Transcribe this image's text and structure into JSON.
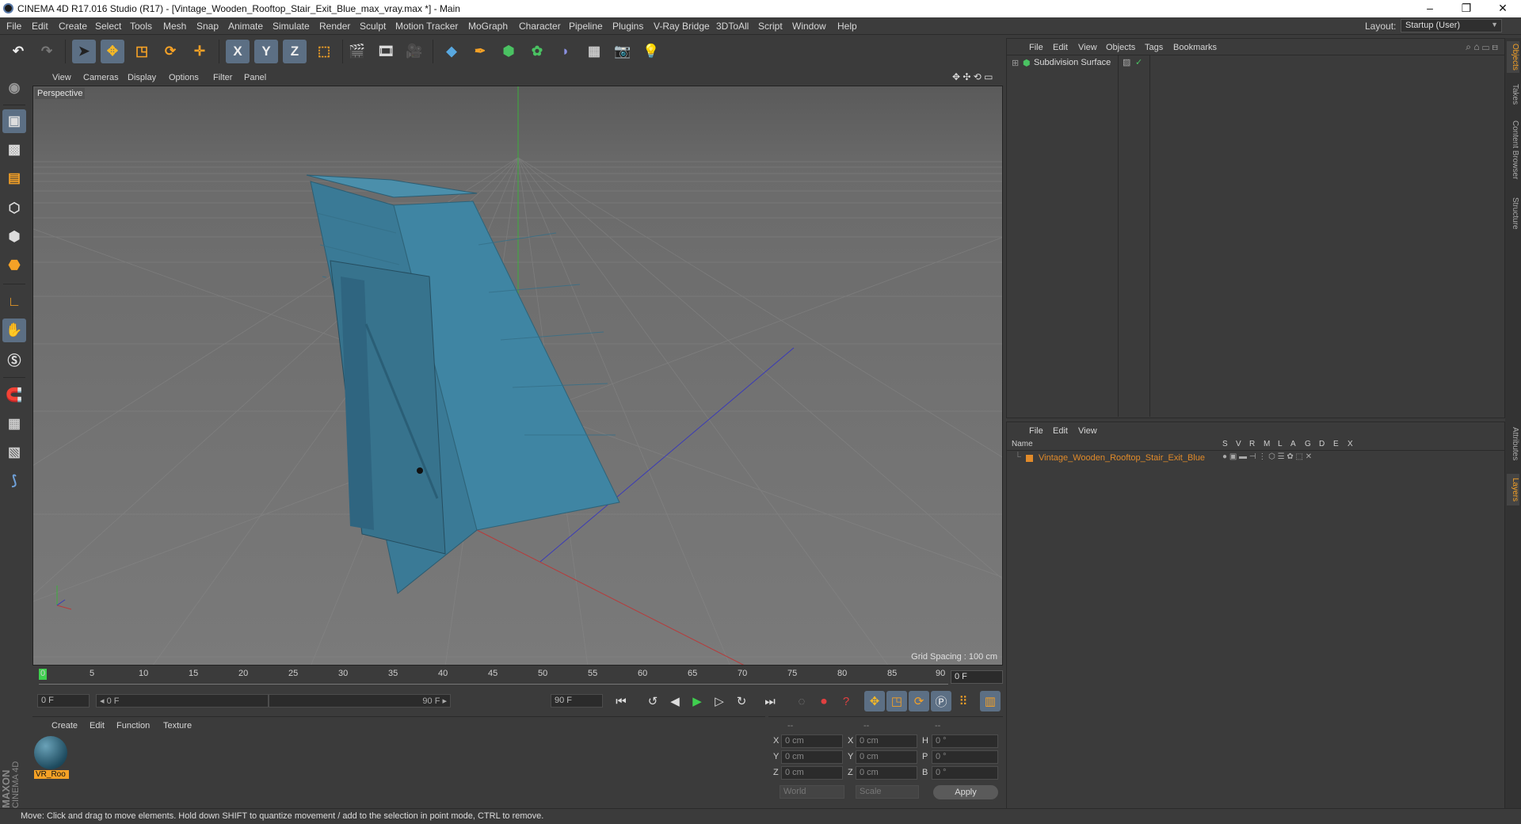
{
  "window": {
    "title": "CINEMA 4D R17.016 Studio (R17) - [Vintage_Wooden_Rooftop_Stair_Exit_Blue_max_vray.max *] - Main",
    "minimize": "–",
    "restore": "❐",
    "close": "✕"
  },
  "menu": [
    "File",
    "Edit",
    "Create",
    "Select",
    "Tools",
    "Mesh",
    "Snap",
    "Animate",
    "Simulate",
    "Render",
    "Sculpt",
    "Motion Tracker",
    "MoGraph",
    "Character",
    "Pipeline",
    "Plugins",
    "V-Ray Bridge",
    "3DToAll",
    "Script",
    "Window",
    "Help"
  ],
  "layout": {
    "label": "Layout:",
    "value": "Startup (User)"
  },
  "toolbar": {
    "x_label": "X",
    "y_label": "Y",
    "z_label": "Z"
  },
  "viewport": {
    "menu": [
      "View",
      "Cameras",
      "Display",
      "Options",
      "Filter",
      "Panel"
    ],
    "label": "Perspective",
    "grid_spacing": "Grid Spacing : 100 cm"
  },
  "timeline": {
    "ticks": [
      "0",
      "5",
      "10",
      "15",
      "20",
      "25",
      "30",
      "35",
      "40",
      "45",
      "50",
      "55",
      "60",
      "65",
      "70",
      "75",
      "80",
      "85",
      "90"
    ],
    "current_frame": "0 F"
  },
  "controls": {
    "start_field": "0 F",
    "range_left": "◂ 0 F",
    "range_right": "90 F ▸",
    "end_field": "90 F"
  },
  "materials": {
    "menu": [
      "Create",
      "Edit",
      "Function",
      "Texture"
    ],
    "items": [
      {
        "name": "VR_Roo"
      }
    ]
  },
  "coordinates": {
    "header": [
      "--",
      "--",
      "--"
    ],
    "rows": [
      {
        "a": "X",
        "av": "0 cm",
        "b": "X",
        "bv": "0 cm",
        "c": "H",
        "cv": "0 °"
      },
      {
        "a": "Y",
        "av": "0 cm",
        "b": "Y",
        "bv": "0 cm",
        "c": "P",
        "cv": "0 °"
      },
      {
        "a": "Z",
        "av": "0 cm",
        "b": "Z",
        "bv": "0 cm",
        "c": "B",
        "cv": "0 °"
      }
    ],
    "world": "World",
    "scale": "Scale",
    "apply": "Apply"
  },
  "objects_panel": {
    "menu": [
      "File",
      "Edit",
      "View",
      "Objects",
      "Tags",
      "Bookmarks"
    ],
    "objects": [
      {
        "name": "Subdivision Surface"
      }
    ]
  },
  "layers_panel": {
    "menu": [
      "File",
      "Edit",
      "View"
    ],
    "columns": [
      "Name",
      "S",
      "V",
      "R",
      "M",
      "L",
      "A",
      "G",
      "D",
      "E",
      "X"
    ],
    "rows": [
      {
        "name": "Vintage_Wooden_Rooftop_Stair_Exit_Blue"
      }
    ]
  },
  "side_tabs": [
    "Objects",
    "Takes",
    "Content Browser",
    "Structure",
    "Attributes",
    "Layers"
  ],
  "branding": {
    "maxon": "MAXON",
    "cinema": "CINEMA 4D"
  },
  "status": "Move: Click and drag to move elements. Hold down SHIFT to quantize movement / add to the selection in point mode, CTRL to remove.",
  "colors": {
    "object_orange": "#e08a2a",
    "door_blue": "#3d7e9a",
    "accent_active": "#5c6f84"
  }
}
